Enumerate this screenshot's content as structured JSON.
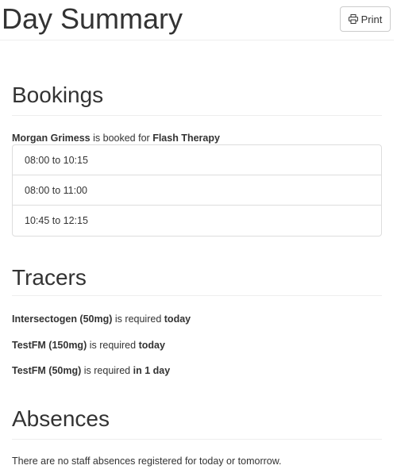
{
  "header": {
    "title": "Day Summary",
    "print_label": "Print",
    "print_icon": "printer-icon"
  },
  "bookings": {
    "title": "Bookings",
    "booking": {
      "person": "Morgan Grimess",
      "connector": "is booked for",
      "therapy": "Flash Therapy"
    },
    "slots": [
      "08:00 to 10:15",
      "08:00 to 11:00",
      "10:45 to 12:15"
    ]
  },
  "tracers": {
    "title": "Tracers",
    "items": [
      {
        "name": "Intersectogen (50mg)",
        "connector": "is required",
        "when": "today"
      },
      {
        "name": "TestFM (150mg)",
        "connector": "is required",
        "when": "today"
      },
      {
        "name": "TestFM (50mg)",
        "connector": "is required",
        "when": "in 1 day"
      }
    ]
  },
  "absences": {
    "title": "Absences",
    "message": "There are no staff absences registered for today or tomorrow."
  }
}
